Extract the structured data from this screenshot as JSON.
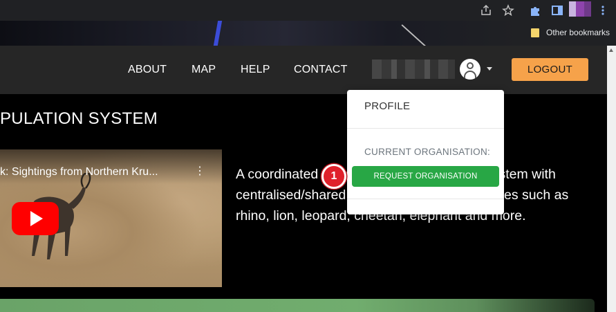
{
  "browser": {
    "bookmarks_label": "Other bookmarks",
    "icons": [
      "share-icon",
      "star-icon",
      "extension-icon",
      "sidepanel-icon",
      "profile-avatar-icon",
      "menu-icon"
    ]
  },
  "nav": {
    "links": [
      "ABOUT",
      "MAP",
      "HELP",
      "CONTACT"
    ],
    "logout_label": "LOGOUT"
  },
  "main": {
    "title": "PULATION SYSTEM",
    "video_title": "k: Sightings from Northern Kru...",
    "description": "A coordinated monitoring and information system with centralised/shared data for high priority species such as rhino, lion, leopard, cheetah, elephant and more."
  },
  "dropdown": {
    "profile_label": "PROFILE",
    "org_label": "CURRENT ORGANISATION:",
    "request_label": "REQUEST ORGANISATION",
    "step_number": "1"
  },
  "colors": {
    "logout": "#f6a24a",
    "request_button": "#28a745",
    "step_badge": "#e0212b",
    "header": "#262626"
  }
}
